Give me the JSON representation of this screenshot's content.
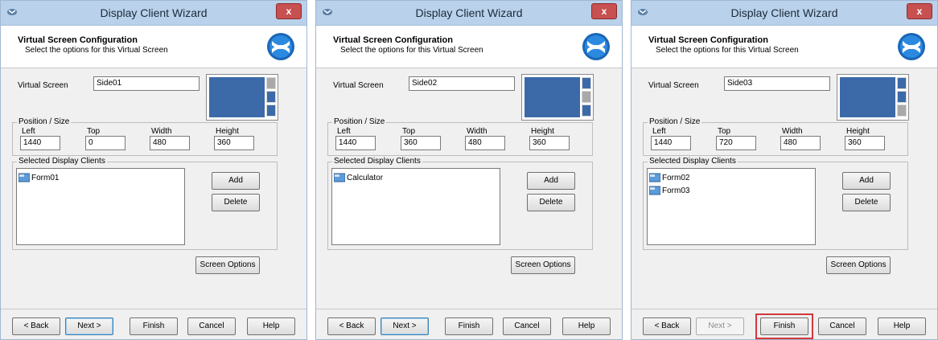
{
  "windows": [
    {
      "title": "Display Client Wizard",
      "close_glyph": "x",
      "header": {
        "title": "Virtual Screen Configuration",
        "subtitle": "Select the options for this Virtual Screen"
      },
      "virtual_screen": {
        "label": "Virtual Screen",
        "value": "Side01",
        "preview_active_slot": 1
      },
      "position": {
        "legend": "Position / Size",
        "left": {
          "label": "Left",
          "value": "1440"
        },
        "top": {
          "label": "Top",
          "value": "0"
        },
        "width": {
          "label": "Width",
          "value": "480"
        },
        "height": {
          "label": "Height",
          "value": "360"
        }
      },
      "clients": {
        "legend": "Selected Display Clients",
        "items": [
          "Form01"
        ],
        "add": "Add",
        "delete": "Delete"
      },
      "screen_options": "Screen Options",
      "buttons": {
        "back": "< Back",
        "next": "Next >",
        "finish": "Finish",
        "cancel": "Cancel",
        "help": "Help"
      },
      "next_disabled": false,
      "finish_highlighted": false
    },
    {
      "title": "Display Client Wizard",
      "close_glyph": "x",
      "header": {
        "title": "Virtual Screen Configuration",
        "subtitle": "Select the options for this Virtual Screen"
      },
      "virtual_screen": {
        "label": "Virtual Screen",
        "value": "Side02",
        "preview_active_slot": 2
      },
      "position": {
        "legend": "Position / Size",
        "left": {
          "label": "Left",
          "value": "1440"
        },
        "top": {
          "label": "Top",
          "value": "360"
        },
        "width": {
          "label": "Width",
          "value": "480"
        },
        "height": {
          "label": "Height",
          "value": "360"
        }
      },
      "clients": {
        "legend": "Selected Display Clients",
        "items": [
          "Calculator"
        ],
        "add": "Add",
        "delete": "Delete"
      },
      "screen_options": "Screen Options",
      "buttons": {
        "back": "< Back",
        "next": "Next >",
        "finish": "Finish",
        "cancel": "Cancel",
        "help": "Help"
      },
      "next_disabled": false,
      "finish_highlighted": false
    },
    {
      "title": "Display Client Wizard",
      "close_glyph": "x",
      "header": {
        "title": "Virtual Screen Configuration",
        "subtitle": "Select the options for this Virtual Screen"
      },
      "virtual_screen": {
        "label": "Virtual Screen",
        "value": "Side03",
        "preview_active_slot": 3
      },
      "position": {
        "legend": "Position / Size",
        "left": {
          "label": "Left",
          "value": "1440"
        },
        "top": {
          "label": "Top",
          "value": "720"
        },
        "width": {
          "label": "Width",
          "value": "480"
        },
        "height": {
          "label": "Height",
          "value": "360"
        }
      },
      "clients": {
        "legend": "Selected Display Clients",
        "items": [
          "Form02",
          "Form03"
        ],
        "add": "Add",
        "delete": "Delete"
      },
      "screen_options": "Screen Options",
      "buttons": {
        "back": "< Back",
        "next": "Next >",
        "finish": "Finish",
        "cancel": "Cancel",
        "help": "Help"
      },
      "next_disabled": true,
      "finish_highlighted": true
    }
  ],
  "colors": {
    "titlebar": "#b9d1ea",
    "close": "#c75050",
    "preview_fill": "#3c6aa8",
    "highlight": "#d1383c"
  }
}
